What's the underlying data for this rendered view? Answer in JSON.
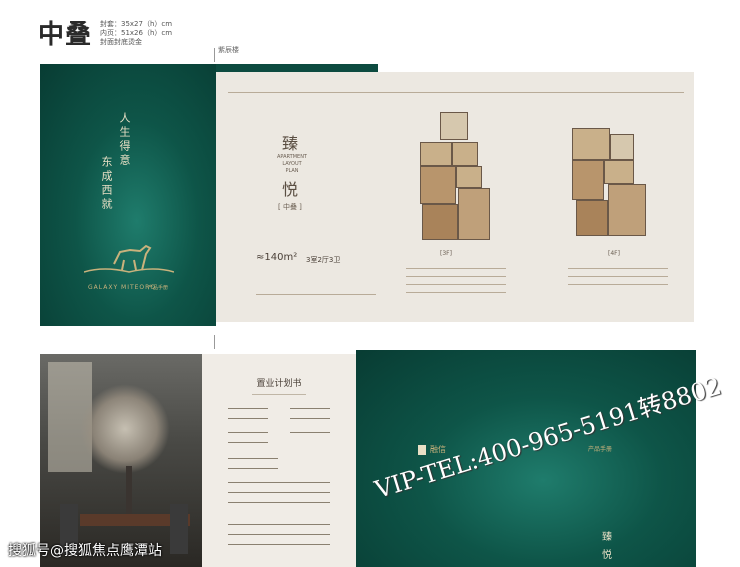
{
  "header": {
    "title": "中叠",
    "specs": [
      "封套：35x27（h）cm",
      "内页：51x26（h）cm",
      "封面封底烫金"
    ],
    "tag": "紫辰楼"
  },
  "cover": {
    "poem_lines": [
      "人生得意",
      "东成西就"
    ],
    "brand_en": "GALAXY MITEORO",
    "brand_cn": "产品手册"
  },
  "plan": {
    "title_top": "臻",
    "title_en": [
      "APARTMENT",
      "LAYOUT",
      "PLAN"
    ],
    "title_bottom": "悦",
    "label": "[ 中叠 ]",
    "area": "≈140m²",
    "rooms": "3室2厅3卫",
    "floor_a": "[3F]",
    "floor_b": "[4F]"
  },
  "purchase": {
    "title": "置业计划书"
  },
  "back": {
    "logo": "融信",
    "logo_sub": "产品手册",
    "bottom_top": "臻",
    "bottom_bottom": "悦"
  },
  "overlay": {
    "vip": "VIP-TEL:400-965-5191转8802",
    "watermark": "搜狐号@搜狐焦点鹰潭站"
  }
}
